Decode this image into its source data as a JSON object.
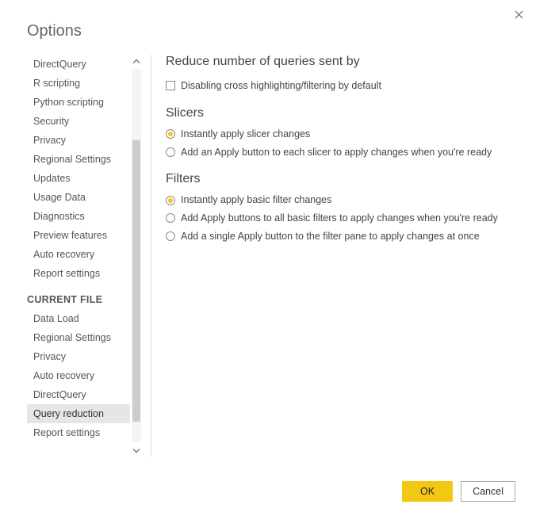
{
  "dialog": {
    "title": "Options",
    "ok_label": "OK",
    "cancel_label": "Cancel"
  },
  "sidebar": {
    "global_items": [
      "DirectQuery",
      "R scripting",
      "Python scripting",
      "Security",
      "Privacy",
      "Regional Settings",
      "Updates",
      "Usage Data",
      "Diagnostics",
      "Preview features",
      "Auto recovery",
      "Report settings"
    ],
    "current_file_header": "CURRENT FILE",
    "current_items": [
      "Data Load",
      "Regional Settings",
      "Privacy",
      "Auto recovery",
      "DirectQuery",
      "Query reduction",
      "Report settings"
    ],
    "selected": "Query reduction"
  },
  "content": {
    "reduce_heading": "Reduce number of queries sent by",
    "disable_cross": "Disabling cross highlighting/filtering by default",
    "slicers_heading": "Slicers",
    "slicer_opt1": "Instantly apply slicer changes",
    "slicer_opt2": "Add an Apply button to each slicer to apply changes when you're ready",
    "filters_heading": "Filters",
    "filter_opt1": "Instantly apply basic filter changes",
    "filter_opt2": "Add Apply buttons to all basic filters to apply changes when you're ready",
    "filter_opt3": "Add a single Apply button to the filter pane to apply changes at once"
  }
}
